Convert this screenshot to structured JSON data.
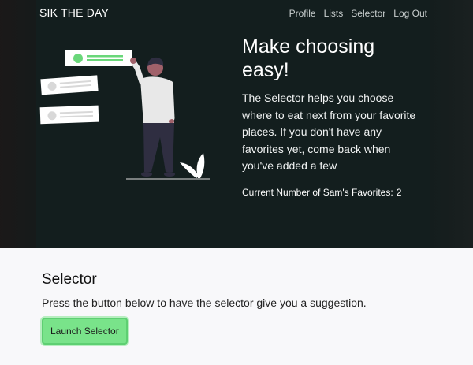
{
  "navbar": {
    "brand": "SIK THE DAY",
    "links": [
      "Profile",
      "Lists",
      "Selector",
      "Log Out"
    ]
  },
  "hero": {
    "title": "Make choosing easy!",
    "description": "The Selector helps you choose where to eat next from your favorite places. If you don't have any favorites yet, come back when you've added a few",
    "favorites_label": "Current Number of Sam's Favorites:",
    "favorites_count": "2"
  },
  "selector": {
    "title": "Selector",
    "description": "Press the button below to have the selector give you a suggestion.",
    "button_label": "Launch Selector"
  },
  "colors": {
    "hero_bg": "#131e1e",
    "accent_green": "#79e38a",
    "page_bg": "#f8f8fa"
  }
}
